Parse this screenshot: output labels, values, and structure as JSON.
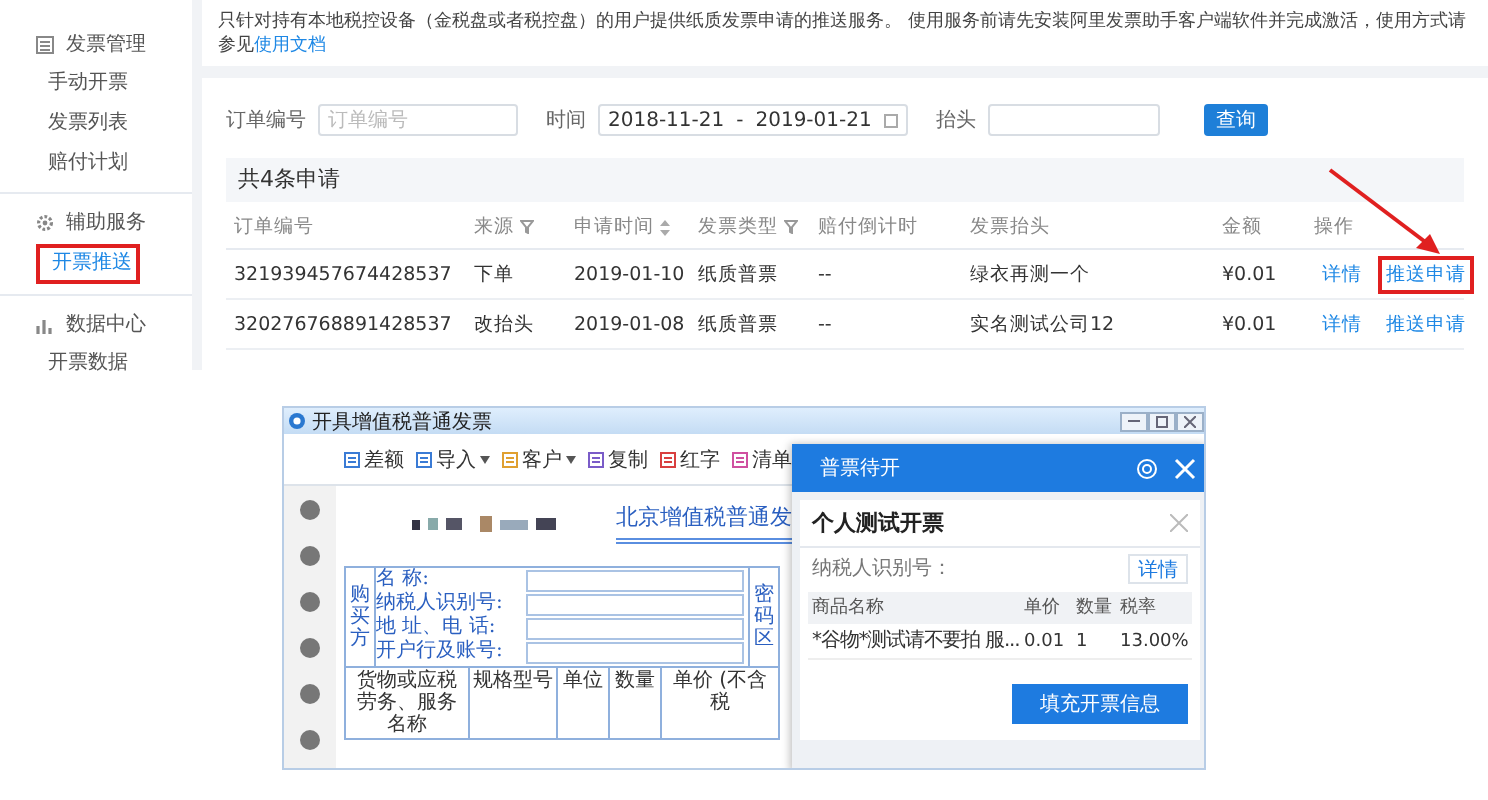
{
  "sidebar": {
    "groups": [
      {
        "title": "发票管理",
        "items": [
          {
            "label": "手动开票",
            "selected": false,
            "highlighted": false
          },
          {
            "label": "发票列表",
            "selected": false,
            "highlighted": false
          },
          {
            "label": "赔付计划",
            "selected": false,
            "highlighted": false
          }
        ]
      },
      {
        "title": "辅助服务",
        "items": [
          {
            "label": "开票推送",
            "selected": true,
            "highlighted": true
          }
        ]
      },
      {
        "title": "数据中心",
        "items": [
          {
            "label": "开票数据",
            "selected": false,
            "highlighted": false
          }
        ]
      }
    ]
  },
  "notice": {
    "text": "只针对持有本地税控设备（金税盘或者税控盘）的用户提供纸质发票申请的推送服务。 使用服务前请先安装阿里发票助手客户端软件并完成激活，使用方式请参见",
    "link": "使用文档"
  },
  "filters": {
    "order_label": "订单编号",
    "order_placeholder": "订单编号",
    "time_label": "时间",
    "date_start": "2018-11-21",
    "date_separator": "-",
    "date_end": "2019-01-21",
    "title_label": "抬头",
    "search_button": "查询"
  },
  "summary": "共4条申请",
  "table": {
    "columns": [
      {
        "label": "订单编号",
        "kind": "plain"
      },
      {
        "label": "来源",
        "kind": "filter"
      },
      {
        "label": "申请时间",
        "kind": "sort"
      },
      {
        "label": "发票类型",
        "kind": "filter"
      },
      {
        "label": "赔付倒计时",
        "kind": "plain"
      },
      {
        "label": "发票抬头",
        "kind": "plain"
      },
      {
        "label": "金额",
        "kind": "plain"
      },
      {
        "label": "操作",
        "kind": "plain"
      }
    ],
    "rows": [
      {
        "cells": [
          "321939457674428537",
          "下单",
          "2019-01-10",
          "纸质普票",
          "--",
          "绿衣再测一个",
          "¥0.01"
        ],
        "actions": [
          {
            "label": "详情",
            "highlighted": false
          },
          {
            "label": "推送申请",
            "highlighted": true
          }
        ]
      },
      {
        "cells": [
          "320276768891428537",
          "改抬头",
          "2019-01-08",
          "纸质普票",
          "--",
          "实名测试公司12",
          "¥0.01"
        ],
        "actions": [
          {
            "label": "详情",
            "highlighted": false
          },
          {
            "label": "推送申请",
            "highlighted": false
          }
        ]
      }
    ]
  },
  "app_window": {
    "title": "开具增值税普通发票",
    "toolbar": [
      {
        "label": "差额",
        "dropdown": false
      },
      {
        "label": "导入",
        "dropdown": true
      },
      {
        "label": "客户",
        "dropdown": true
      },
      {
        "label": "复制",
        "dropdown": false
      },
      {
        "label": "红字",
        "dropdown": false
      },
      {
        "label": "清单",
        "dropdown": false
      }
    ],
    "invoice": {
      "title": "北京增值税普通发",
      "buyer_label": "购买方",
      "fields": [
        "名 称:",
        "纳税人识别号:",
        "地 址、电 话:",
        "开户行及账号:"
      ],
      "cipher_label": "密码区",
      "columns": [
        "货物或应税劳务、服务名称",
        "规格型号",
        "单位",
        "数量",
        "单价 (不含税"
      ]
    },
    "popup": {
      "header": "普票待开",
      "title": "个人测试开票",
      "taxpayer_label": "纳税人识别号：",
      "detail_button": "详情",
      "columns": [
        "商品名称",
        "单价",
        "数量",
        "税率"
      ],
      "rows": [
        [
          "*谷物*测试请不要拍 服...",
          "0.01",
          "1",
          "13.00%"
        ]
      ],
      "fill_button": "填充开票信息"
    }
  }
}
